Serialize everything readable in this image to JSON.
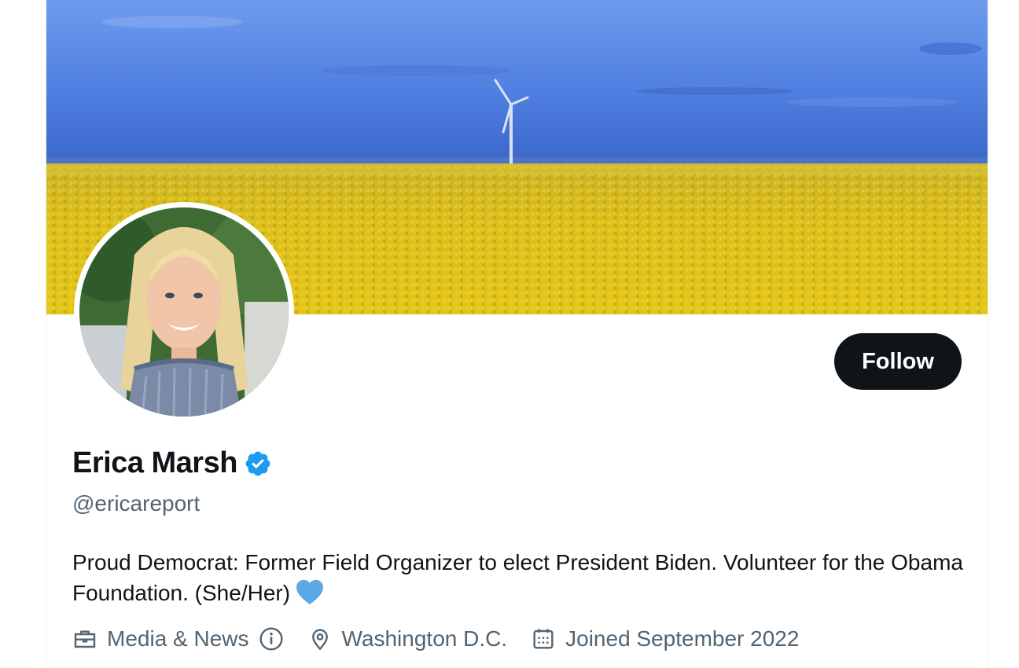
{
  "profile": {
    "display_name": "Erica Marsh",
    "handle": "@ericareport",
    "verified": true,
    "bio": "Proud Democrat: Former Field Organizer to elect President Biden. Volunteer for the Obama Foundation. (She/Her)",
    "bio_emoji": "blue-heart-icon"
  },
  "actions": {
    "follow_label": "Follow"
  },
  "meta": {
    "category": "Media & News",
    "location": "Washington D.C.",
    "joined": "Joined September 2022"
  },
  "images": {
    "banner": "rapeseed-field-with-wind-turbine",
    "avatar": "profile-photo"
  },
  "colors": {
    "verified_blue": "#1d9bf0",
    "follow_bg": "#0f1419",
    "secondary_text": "#536471",
    "heart": "#5aa9e6"
  }
}
